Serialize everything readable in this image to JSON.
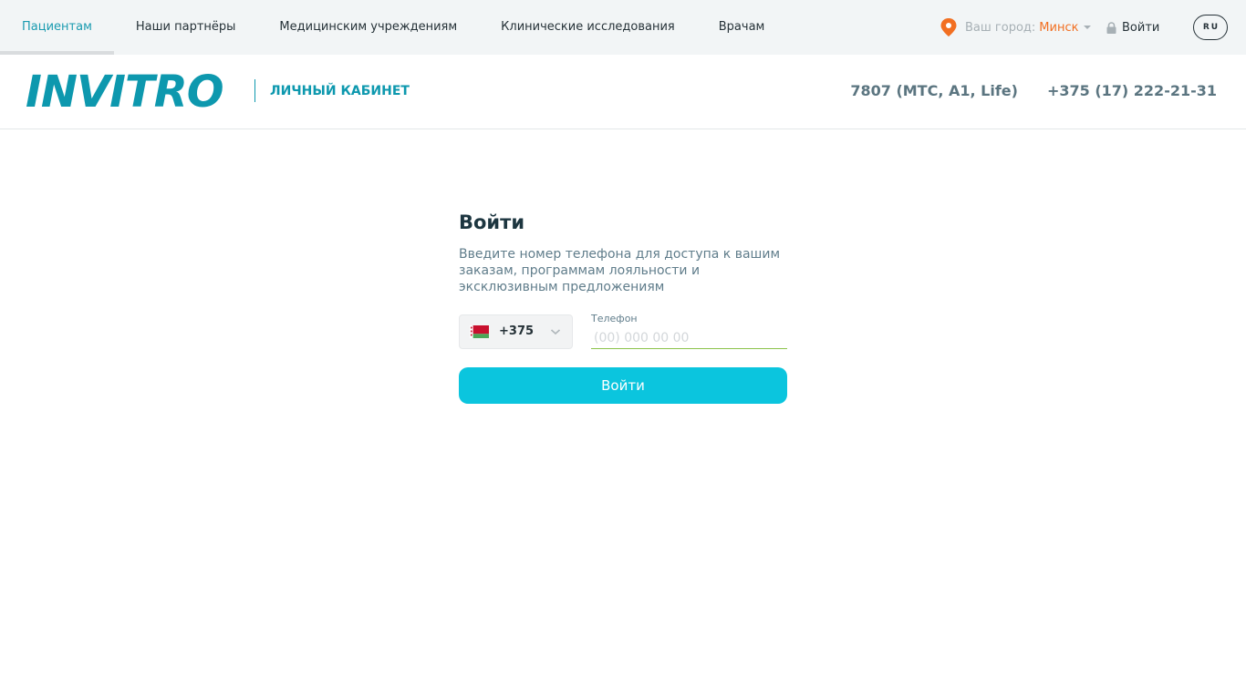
{
  "topnav": {
    "items": [
      {
        "label": "Пациентам",
        "active": true
      },
      {
        "label": "Наши партнёры",
        "active": false
      },
      {
        "label": "Медицинским учреждениям",
        "active": false
      },
      {
        "label": "Клинические исследования",
        "active": false
      },
      {
        "label": "Врачам",
        "active": false
      }
    ],
    "city_label": "Ваш город:",
    "city_name": "Минск",
    "login_label": "Войти",
    "language": "RU"
  },
  "header": {
    "logo": "INVITRO",
    "cabinet_label": "ЛИЧНЫЙ КАБИНЕТ",
    "phones": [
      "7807 (МТС, A1, Life)",
      "+375 (17) 222-21-31"
    ]
  },
  "form": {
    "title": "Войти",
    "description": "Введите номер телефона для доступа к вашим заказам, программам лояльности и эксклюзивным предложениям",
    "country_code": "+375",
    "phone_label": "Телефон",
    "phone_value": "",
    "phone_placeholder": "(00) 000 00 00",
    "submit_label": "Войти"
  },
  "colors": {
    "brand": "#0d98ae",
    "accent_orange": "#f26f21",
    "button": "#0bc5de",
    "input_underline": "#8bc34a"
  },
  "icons": [
    "map-pin-icon",
    "caret-down-icon",
    "lock-icon",
    "belarus-flag-icon",
    "chevron-down-icon"
  ]
}
